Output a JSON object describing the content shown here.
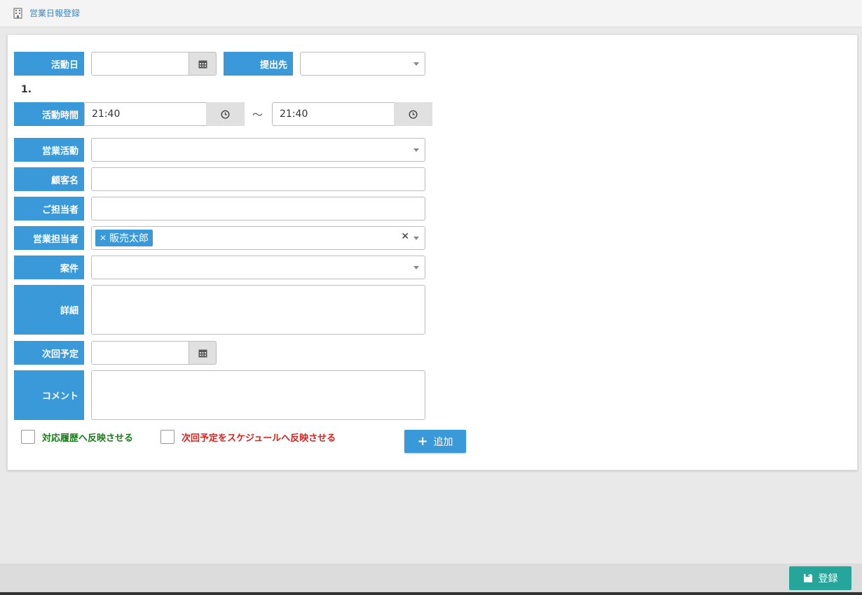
{
  "header": {
    "title": "営業日報登録",
    "icon": "building-icon"
  },
  "form": {
    "activity_date_label": "活動日",
    "activity_date_value": "",
    "submit_to_label": "提出先",
    "submit_to_value": "",
    "entry_number": "1.",
    "activity_time_label": "活動時間",
    "time_start": "21:40",
    "time_separator": "～",
    "time_end": "21:40",
    "sales_activity_label": "営業活動",
    "sales_activity_value": "",
    "customer_name_label": "顧客名",
    "customer_name_value": "",
    "contact_person_label": "ご担当者",
    "contact_person_value": "",
    "sales_rep_label": "営業担当者",
    "sales_rep_tag": "販売太郎",
    "project_label": "案件",
    "project_value": "",
    "details_label": "詳細",
    "details_value": "",
    "next_plan_label": "次回予定",
    "next_plan_value": "",
    "comment_label": "コメント",
    "comment_value": "",
    "reflect_history_label": "対応履歴へ反映させる",
    "reflect_history_checked": false,
    "reflect_schedule_label": "次回予定をスケジュールへ反映させる",
    "reflect_schedule_checked": false,
    "add_button": "追加"
  },
  "footer": {
    "save_button": "登録"
  },
  "colors": {
    "label_bg": "#3a9ad9",
    "save_button": "#26a69a",
    "reflect_history_text": "#1a7a1a",
    "reflect_schedule_text": "#e0201a",
    "title_link": "#3a87c4"
  }
}
